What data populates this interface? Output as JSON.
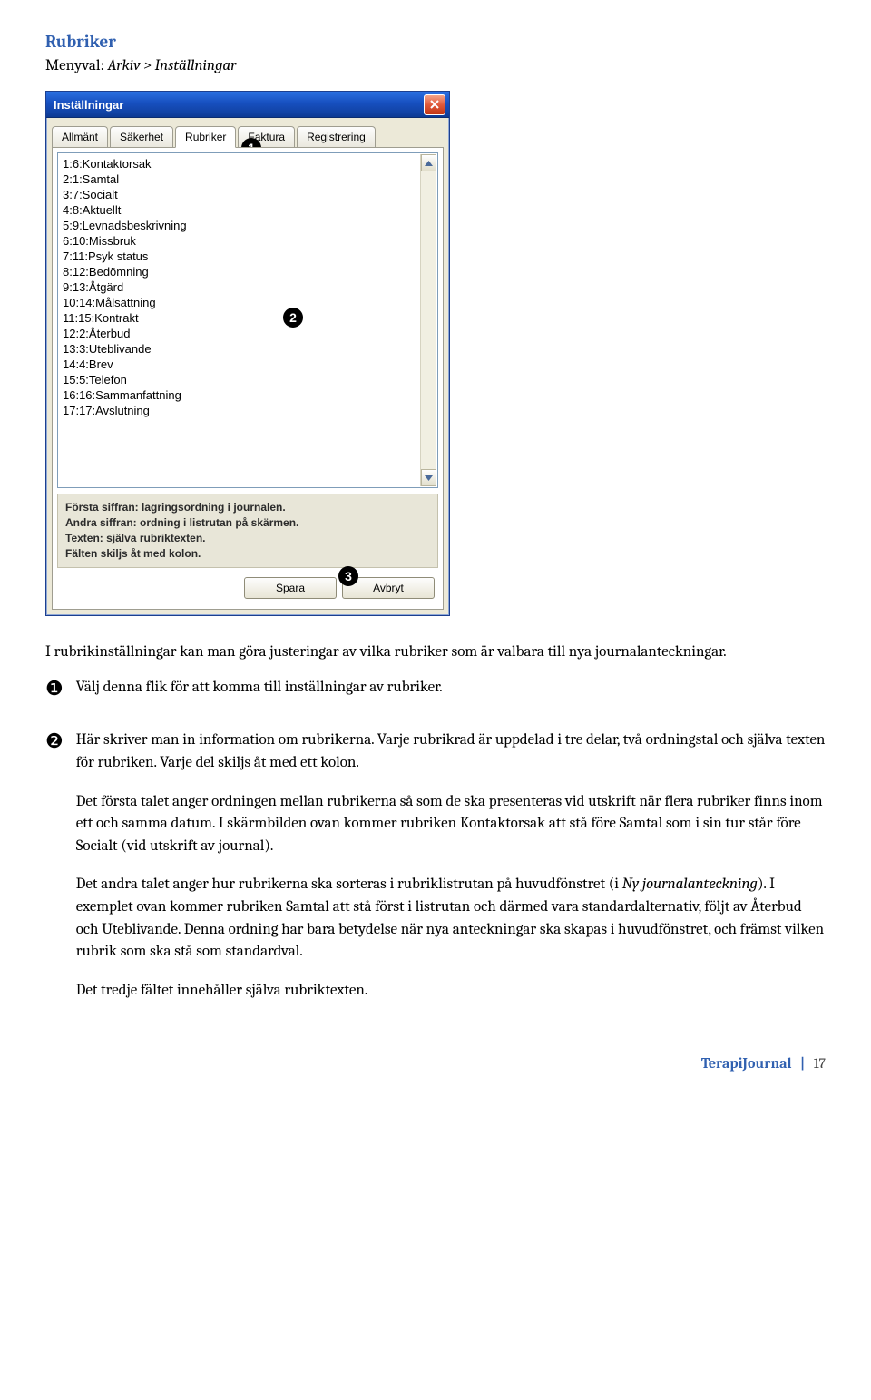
{
  "section_title": "Rubriker",
  "breadcrumb_prefix": "Menyval: ",
  "breadcrumb_path": "Arkiv > Inställningar",
  "window": {
    "title": "Inställningar",
    "tabs": [
      "Allmänt",
      "Säkerhet",
      "Rubriker",
      "Faktura",
      "Registrering"
    ],
    "active_tab_index": 2,
    "list_items": [
      "1:6:Kontaktorsak",
      "2:1:Samtal",
      "3:7:Socialt",
      "4:8:Aktuellt",
      "5:9:Levnadsbeskrivning",
      "6:10:Missbruk",
      "7:11:Psyk status",
      "8:12:Bedömning",
      "9:13:Åtgärd",
      "10:14:Målsättning",
      "11:15:Kontrakt",
      "12:2:Återbud",
      "13:3:Uteblivande",
      "14:4:Brev",
      "15:5:Telefon",
      "16:16:Sammanfattning",
      "17:17:Avslutning"
    ],
    "info_lines": [
      "Första siffran: lagringsordning i journalen.",
      "Andra siffran: ordning i listrutan på skärmen.",
      "Texten: själva rubriktexten.",
      "Fälten skiljs åt med kolon."
    ],
    "buttons": {
      "save": "Spara",
      "cancel": "Avbryt"
    },
    "callouts": {
      "one": "1",
      "two": "2",
      "three": "3"
    }
  },
  "intro": "I rubrikinställningar kan man göra justeringar av vilka rubriker som är valbara till nya journalanteckningar.",
  "items": {
    "i1_badge": "❶",
    "i1_text": "Välj denna flik för att komma till inställningar av rubriker.",
    "i2_badge": "❷",
    "i2_p1": "Här skriver man in information om rubrikerna. Varje rubrikrad är uppdelad i tre delar, två ordningstal och själva texten för rubriken. Varje del skiljs åt med ett kolon.",
    "i2_p2": "Det första talet anger ordningen mellan rubrikerna så som de ska presenteras vid utskrift när flera rubriker finns inom ett och samma datum. I skärmbilden ovan kommer rubriken Kontaktorsak att stå före Samtal som i sin tur står före Socialt (vid utskrift av journal).",
    "i2_p3a": "Det andra talet anger hur rubrikerna ska sorteras i rubriklistrutan på huvudfönstret (i ",
    "i2_p3_em": "Ny journalanteckning",
    "i2_p3b": "). I exemplet ovan kommer rubriken Samtal att stå först i listrutan och därmed vara standardalternativ, följt av Återbud och Uteblivande. Denna ordning har bara betydelse när nya anteckningar ska skapas i huvudfönstret, och främst vilken rubrik som ska stå som standardval.",
    "i2_p4": "Det tredje fältet innehåller själva rubriktexten."
  },
  "footer": {
    "brand": "TerapiJournal",
    "page": "17"
  }
}
